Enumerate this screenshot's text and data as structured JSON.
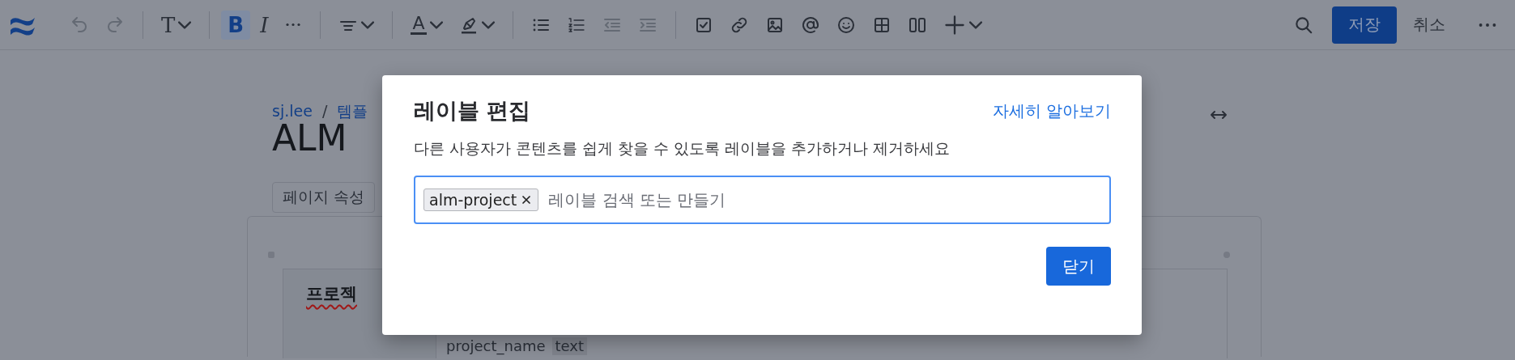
{
  "toolbar": {
    "items": [
      {
        "kind": "logo"
      },
      {
        "kind": "undo",
        "disabled": true
      },
      {
        "kind": "redo",
        "disabled": true
      },
      {
        "kind": "separator"
      },
      {
        "kind": "letter",
        "label": "T",
        "dropdown": true,
        "disabled": false
      },
      {
        "kind": "separator"
      },
      {
        "kind": "letter",
        "label": "B",
        "bold": true,
        "disabled": false,
        "active": true
      },
      {
        "kind": "letter",
        "label": "I",
        "italic": true,
        "disabled": false,
        "active": false
      },
      {
        "kind": "more",
        "disabled": false
      },
      {
        "kind": "separator"
      },
      {
        "kind": "align",
        "dropdown": true,
        "disabled": false
      },
      {
        "kind": "separator"
      },
      {
        "kind": "underlined_letter",
        "label": "A",
        "dropdown": true,
        "disabled": false
      },
      {
        "kind": "highlight",
        "dropdown": true,
        "disabled": false
      },
      {
        "kind": "separator"
      },
      {
        "kind": "bullets",
        "disabled": false
      },
      {
        "kind": "numbered",
        "disabled": false
      },
      {
        "kind": "outdent",
        "disabled": true
      },
      {
        "kind": "indent",
        "disabled": true
      },
      {
        "kind": "separator"
      },
      {
        "kind": "checkbox",
        "disabled": false
      },
      {
        "kind": "link",
        "disabled": false
      },
      {
        "kind": "image",
        "disabled": false
      },
      {
        "kind": "mention",
        "disabled": false
      },
      {
        "kind": "emoji",
        "disabled": false
      },
      {
        "kind": "table",
        "disabled": false
      },
      {
        "kind": "columns",
        "disabled": false
      },
      {
        "kind": "plus",
        "dropdown": true,
        "disabled": false
      }
    ],
    "save_button": "저장",
    "cancel_button": "취소"
  },
  "page": {
    "breadcrumbs": [
      "sj.lee",
      "템플"
    ],
    "breadcrumb_separator": "/",
    "title": "ALM",
    "properties_chip": "페이지 속성",
    "table": {
      "header": "프로젝",
      "cells": [
        "project_name",
        "text"
      ]
    }
  },
  "dialog": {
    "title": "레이블 편집",
    "help_link": "자세히 알아보기",
    "description": "다른 사용자가 콘텐츠를 쉽게 찾을 수 있도록 레이블을 추가하거나 제거하세요",
    "field": {
      "tags": [
        {
          "label": "alm-project"
        }
      ],
      "placeholder": "레이블 검색 또는 만들기"
    },
    "close_button": "닫기"
  }
}
